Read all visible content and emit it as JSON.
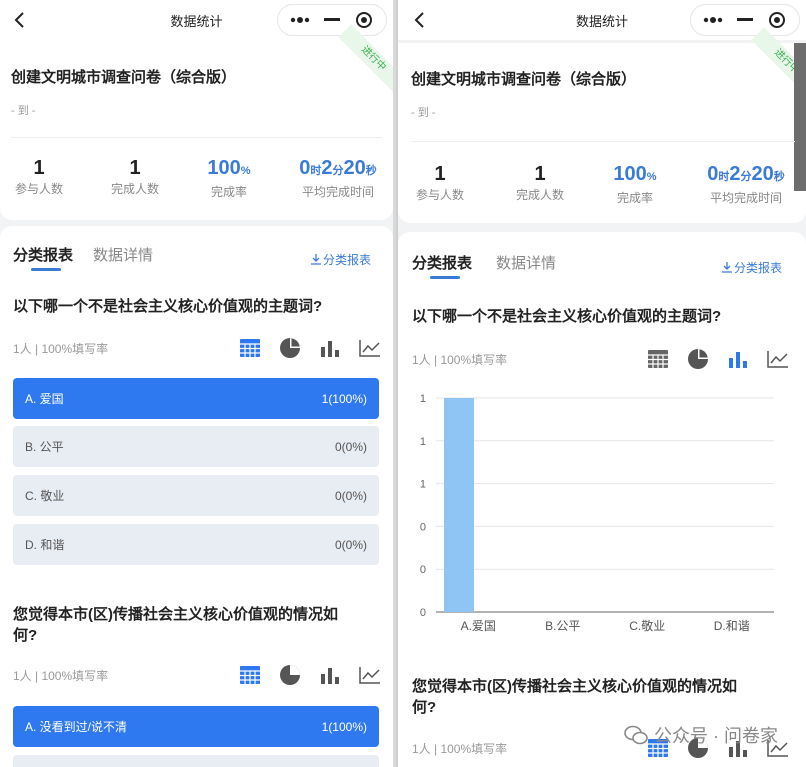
{
  "nav": {
    "title": "数据统计"
  },
  "survey": {
    "title": "创建文明城市调查问卷（综合版）",
    "date_range": "- 到 -",
    "status": "进行中"
  },
  "stats": [
    {
      "value": "1",
      "label": "参与人数"
    },
    {
      "value": "1",
      "label": "完成人数"
    },
    {
      "value": "100",
      "unit": "%",
      "label": "完成率"
    },
    {
      "d1": "0",
      "u1": "时",
      "d2": "2",
      "u2": "分",
      "d3": "20",
      "u3": "秒",
      "label": "平均完成时间"
    }
  ],
  "tabs": {
    "active": "分类报表",
    "inactive": "数据详情",
    "export": "分类报表"
  },
  "q1": {
    "title": "以下哪一个不是社会主义核心价值观的主题词?",
    "meta": "1人 | 100%填写率",
    "options": [
      {
        "label": "A. 爱国",
        "result": "1(100%)"
      },
      {
        "label": "B. 公平",
        "result": "0(0%)"
      },
      {
        "label": "C. 敬业",
        "result": "0(0%)"
      },
      {
        "label": "D. 和谐",
        "result": "0(0%)"
      }
    ]
  },
  "q2": {
    "title_l1": "您觉得本市(区)传播社会主义核心价值观的情况如",
    "title_l2": "何?",
    "meta": "1人 | 100%填写率",
    "options": [
      {
        "label": "A. 没看到过/说不清",
        "result": "1(100%)"
      }
    ]
  },
  "chart_data": {
    "type": "bar",
    "categories": [
      "A.爱国",
      "B.公平",
      "C.敬业",
      "D.和谐"
    ],
    "values": [
      1,
      0,
      0,
      0
    ],
    "y_tick_labels": [
      "1",
      "1",
      "1",
      "0",
      "0",
      "0"
    ],
    "ylim": [
      0,
      1
    ],
    "grid": true,
    "bar_color": "#8ec5f5"
  },
  "watermark": {
    "text": "公众号 · 问卷家"
  },
  "colors": {
    "accent": "#2e78f0",
    "status_green": "#37b24d"
  }
}
